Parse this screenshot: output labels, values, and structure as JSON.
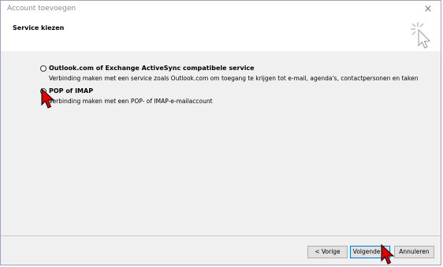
{
  "window": {
    "title": "Account toevoegen",
    "close_glyph": "×"
  },
  "header": {
    "title": "Service kiezen",
    "icon": "cursor-click-icon"
  },
  "options": [
    {
      "label": "Outlook.com of Exchange ActiveSync compatibele service",
      "description": "Verbinding maken met een service zoals Outlook.com om toegang te krijgen tot e-mail, agenda's, contactpersonen en taken",
      "checked": false
    },
    {
      "label": "POP of IMAP",
      "description": "Verbinding maken met een POP- of IMAP-e-mailaccount",
      "checked": true
    }
  ],
  "buttons": {
    "back": "< Vorige",
    "next": "Volgende >",
    "cancel": "Annuleren"
  },
  "colors": {
    "cursor": "#e00000",
    "focus": "#0078d7"
  }
}
